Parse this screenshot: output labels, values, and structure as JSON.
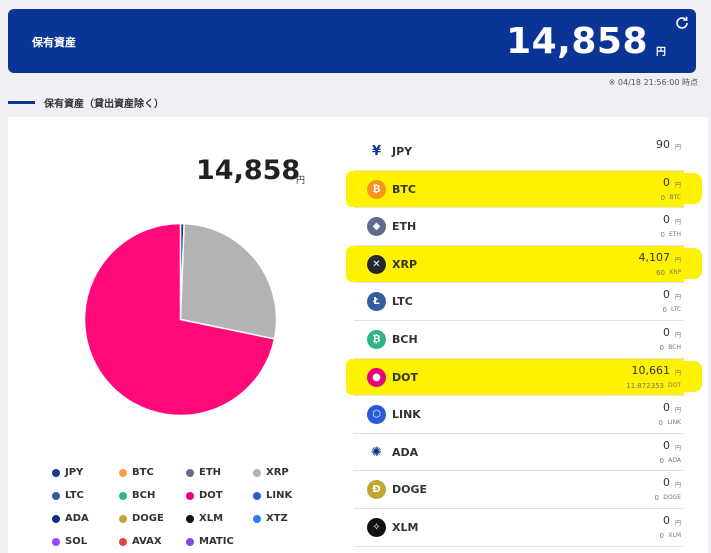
{
  "header": {
    "label": "保有資産",
    "total": "14,858",
    "unit": "円",
    "timestamp": "※ 04/18 21:56:00 時点"
  },
  "section": {
    "title": "保有資産（貸出資産除く）"
  },
  "summary": {
    "total": "14,858",
    "unit": "円"
  },
  "chart_data": {
    "type": "pie",
    "slices": [
      {
        "label": "JPY",
        "value": 90,
        "color": "#1a2f8a"
      },
      {
        "label": "XRP",
        "value": 4107,
        "color": "#b3b3b3"
      },
      {
        "label": "DOT",
        "value": 10661,
        "color": "#ff0a78"
      }
    ]
  },
  "legend": [
    {
      "label": "JPY",
      "color": "#1a3a8f"
    },
    {
      "label": "BTC",
      "color": "#f5a23c"
    },
    {
      "label": "ETH",
      "color": "#636b8c"
    },
    {
      "label": "XRP",
      "color": "#b3b3b3"
    },
    {
      "label": "LTC",
      "color": "#345d9d"
    },
    {
      "label": "BCH",
      "color": "#2fb384"
    },
    {
      "label": "DOT",
      "color": "#e6007a"
    },
    {
      "label": "LINK",
      "color": "#2a5ada"
    },
    {
      "label": "ADA",
      "color": "#0d2d8a"
    },
    {
      "label": "DOGE",
      "color": "#c2a633"
    },
    {
      "label": "XLM",
      "color": "#111111"
    },
    {
      "label": "XTZ",
      "color": "#2c7df7"
    },
    {
      "label": "SOL",
      "color": "#9945ff"
    },
    {
      "label": "AVAX",
      "color": "#e84142"
    },
    {
      "label": "MATIC",
      "color": "#8247e5"
    }
  ],
  "assets": [
    {
      "name": "JPY",
      "icon": "yen-icon",
      "glyph": "¥",
      "color": "#ffffff",
      "fg": "#0a3596",
      "jpy": "90",
      "jpy_unit": "円",
      "amount": "",
      "amount_unit": "",
      "highlight": false
    },
    {
      "name": "BTC",
      "icon": "btc-icon",
      "glyph": "₿",
      "color": "#f7931a",
      "fg": "#ffffff",
      "jpy": "0",
      "jpy_unit": "円",
      "amount": "0",
      "amount_unit": "BTC",
      "highlight": true
    },
    {
      "name": "ETH",
      "icon": "eth-icon",
      "glyph": "◆",
      "color": "#636b8c",
      "fg": "#ffffff",
      "jpy": "0",
      "jpy_unit": "円",
      "amount": "0",
      "amount_unit": "ETH",
      "highlight": false
    },
    {
      "name": "XRP",
      "icon": "xrp-icon",
      "glyph": "✕",
      "color": "#23292f",
      "fg": "#ffffff",
      "jpy": "4,107",
      "jpy_unit": "円",
      "amount": "60",
      "amount_unit": "XRP",
      "highlight": true
    },
    {
      "name": "LTC",
      "icon": "ltc-icon",
      "glyph": "Ł",
      "color": "#345d9d",
      "fg": "#ffffff",
      "jpy": "0",
      "jpy_unit": "円",
      "amount": "0",
      "amount_unit": "LTC",
      "highlight": false
    },
    {
      "name": "BCH",
      "icon": "bch-icon",
      "glyph": "₿",
      "color": "#2fb384",
      "fg": "#ffffff",
      "jpy": "0",
      "jpy_unit": "円",
      "amount": "0",
      "amount_unit": "BCH",
      "highlight": false
    },
    {
      "name": "DOT",
      "icon": "dot-icon",
      "glyph": "●",
      "color": "#e6007a",
      "fg": "#ffffff",
      "jpy": "10,661",
      "jpy_unit": "円",
      "amount": "11.872353",
      "amount_unit": "DOT",
      "highlight": true
    },
    {
      "name": "LINK",
      "icon": "link-icon",
      "glyph": "⬡",
      "color": "#2a5ada",
      "fg": "#ffffff",
      "jpy": "0",
      "jpy_unit": "円",
      "amount": "0",
      "amount_unit": "LINK",
      "highlight": false
    },
    {
      "name": "ADA",
      "icon": "ada-icon",
      "glyph": "✺",
      "color": "#ffffff",
      "fg": "#0d2d8a",
      "jpy": "0",
      "jpy_unit": "円",
      "amount": "0",
      "amount_unit": "ADA",
      "highlight": false
    },
    {
      "name": "DOGE",
      "icon": "doge-icon",
      "glyph": "Ð",
      "color": "#c2a633",
      "fg": "#ffffff",
      "jpy": "0",
      "jpy_unit": "円",
      "amount": "0",
      "amount_unit": "DOGE",
      "highlight": false
    },
    {
      "name": "XLM",
      "icon": "xlm-icon",
      "glyph": "✧",
      "color": "#111111",
      "fg": "#ffffff",
      "jpy": "0",
      "jpy_unit": "円",
      "amount": "0",
      "amount_unit": "XLM",
      "highlight": false
    }
  ]
}
